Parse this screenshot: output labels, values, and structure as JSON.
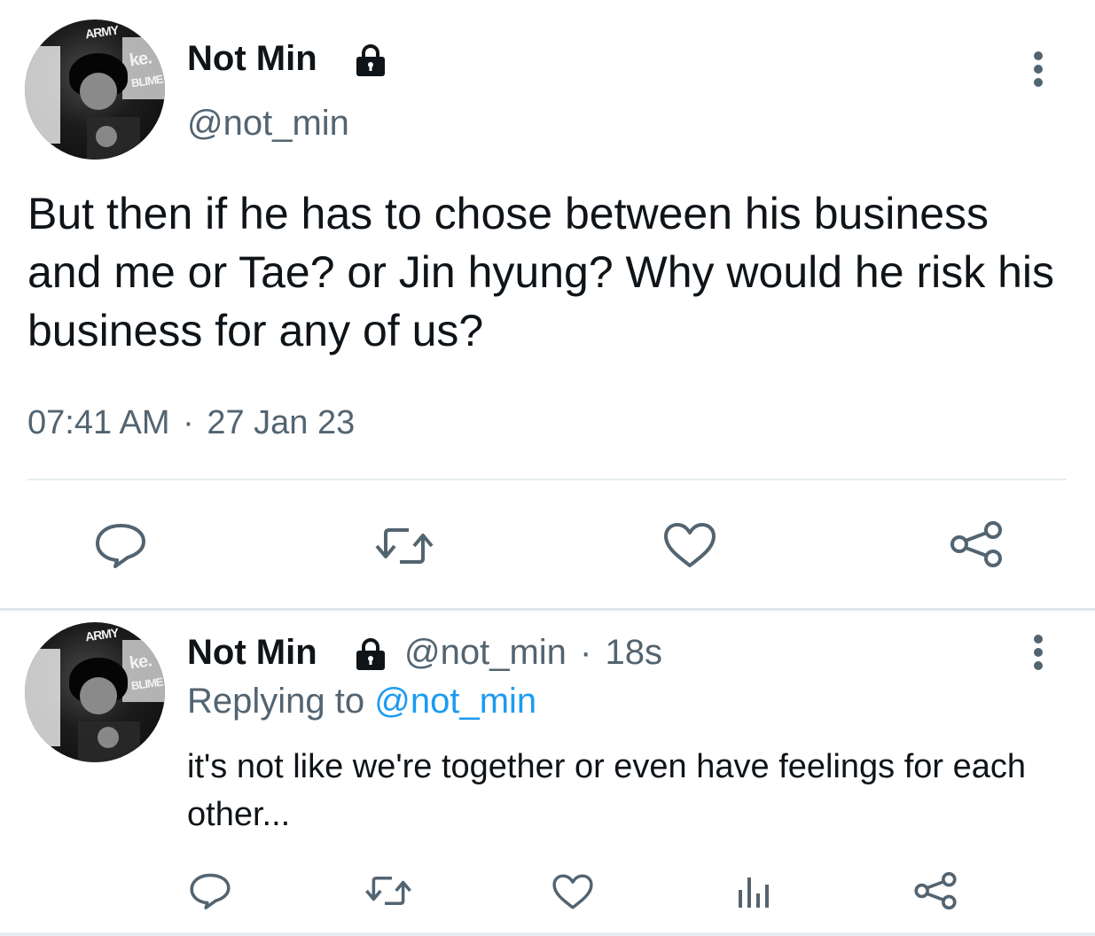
{
  "main_tweet": {
    "display_name": "Not Min",
    "handle": "@not_min",
    "text": "But then if he has to chose between his business and me or Tae? or Jin hyung? Why would he risk his business for any of us?",
    "time": "07:41 AM",
    "separator": "·",
    "date": "27 Jan 23",
    "avatar_text": [
      "ARMY",
      "ke.",
      "BLIME"
    ],
    "actions": [
      "reply-icon",
      "retweet-icon",
      "like-icon",
      "share-icon"
    ]
  },
  "reply_tweet": {
    "display_name": "Not Min",
    "handle": "@not_min",
    "separator": "·",
    "age": "18s",
    "replying_label": "Replying to",
    "replying_handle": "@not_min",
    "text": "it's not like we're together or even have feelings for each other...",
    "avatar_text": [
      "ARMY",
      "ke.",
      "BLIME"
    ],
    "actions": [
      "reply-icon",
      "retweet-icon",
      "like-icon",
      "analytics-icon",
      "share-icon"
    ]
  },
  "colors": {
    "text_primary": "#0f1419",
    "text_secondary": "#536471",
    "link": "#1d9bf0",
    "icon": "#536471",
    "divider": "#e6ecf0"
  }
}
